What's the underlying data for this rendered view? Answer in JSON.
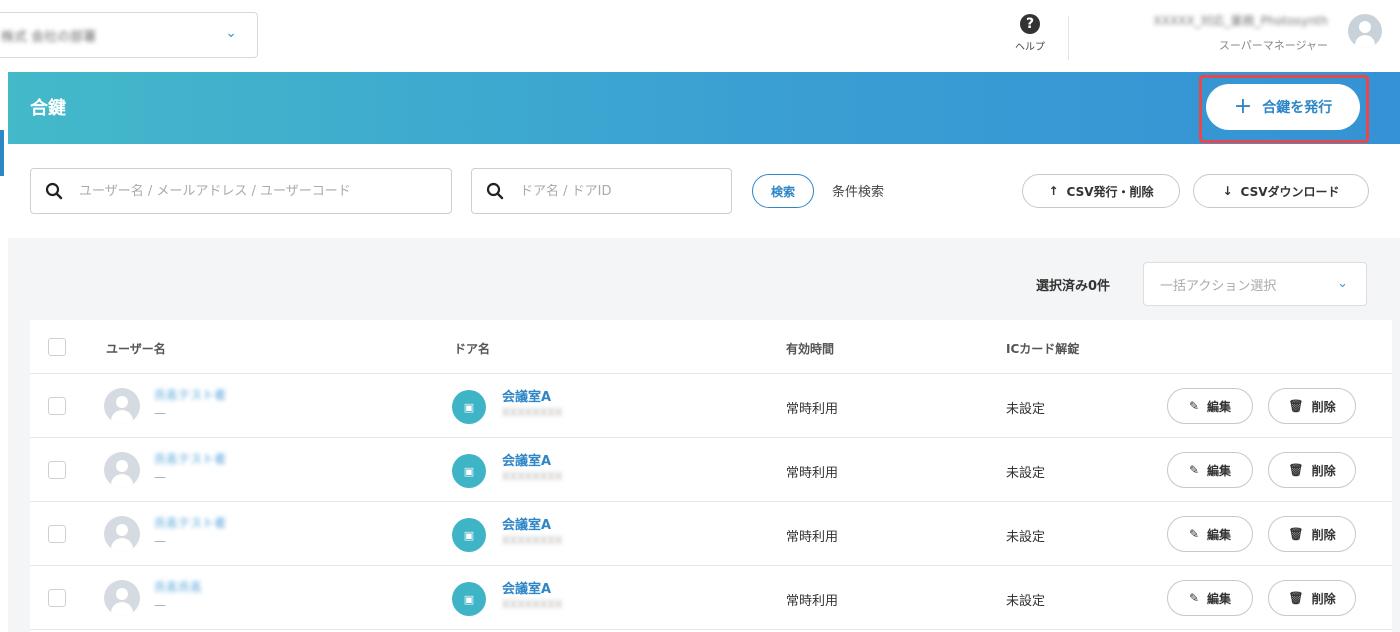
{
  "header": {
    "org_selector_value": "株式 会社の部署",
    "help_label": "ヘルプ",
    "user_name": "XXXXX_対応_業務_Photosynth",
    "user_role": "スーパーマネージャー"
  },
  "banner": {
    "title": "合鍵",
    "issue_button_label": "合鍵を発行"
  },
  "search": {
    "user_placeholder": "ユーザー名 / メールアドレス / ユーザーコード",
    "door_placeholder": "ドア名 / ドアID",
    "search_button": "検索",
    "condition_search": "条件検索",
    "csv_issue_delete": "CSV発行・削除",
    "csv_download": "CSVダウンロード"
  },
  "bulk": {
    "selected_count_label": "選択済み0件",
    "action_placeholder": "一括アクション選択"
  },
  "table": {
    "columns": {
      "user": "ユーザー名",
      "door": "ドア名",
      "valid_time": "有効時間",
      "ic_card": "ICカード解錠"
    },
    "rows": [
      {
        "user_name": "氏名テスト者",
        "user_sub": "—",
        "door_name": "会議室A",
        "door_sub": "XXXXXXXX",
        "valid_time": "常時利用",
        "ic_card": "未設定",
        "edit": "編集",
        "delete": "削除"
      },
      {
        "user_name": "氏名テスト者",
        "user_sub": "—",
        "door_name": "会議室A",
        "door_sub": "XXXXXXXX",
        "valid_time": "常時利用",
        "ic_card": "未設定",
        "edit": "編集",
        "delete": "削除"
      },
      {
        "user_name": "氏名テスト者",
        "user_sub": "—",
        "door_name": "会議室A",
        "door_sub": "XXXXXXXX",
        "valid_time": "常時利用",
        "ic_card": "未設定",
        "edit": "編集",
        "delete": "削除"
      },
      {
        "user_name": "氏名氏名",
        "user_sub": "—",
        "door_name": "会議室A",
        "door_sub": "XXXXXXXX",
        "valid_time": "常時利用",
        "ic_card": "未設定",
        "edit": "編集",
        "delete": "削除"
      }
    ]
  },
  "colors": {
    "accent": "#2f86c6",
    "banner_start": "#43b9c9",
    "banner_end": "#3592d4",
    "highlight_frame": "#e8484a"
  }
}
